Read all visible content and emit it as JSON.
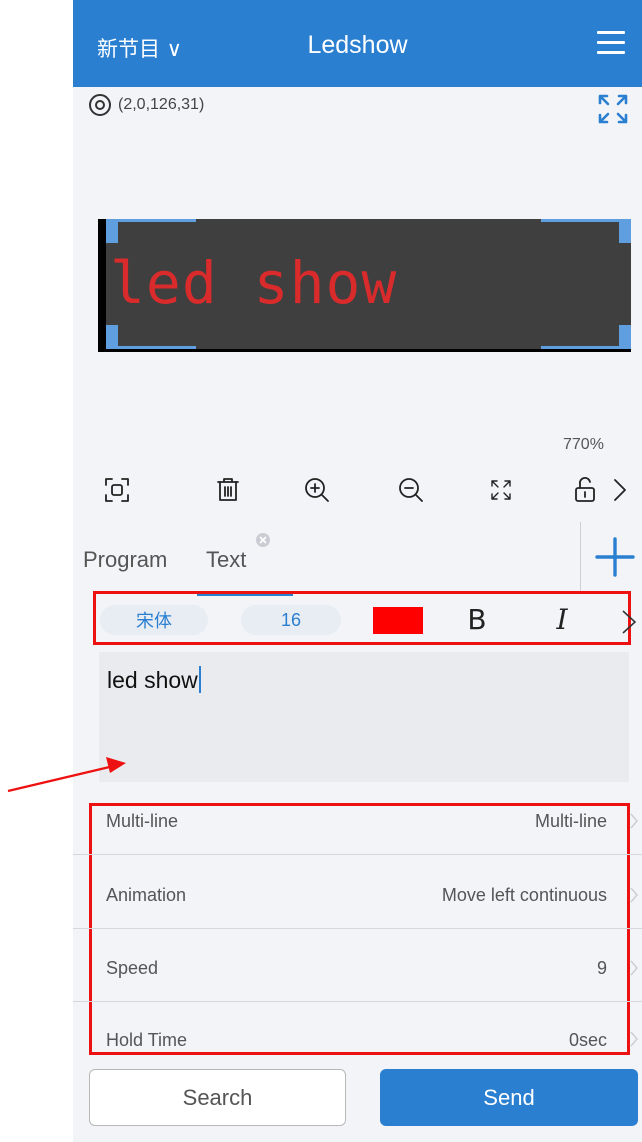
{
  "header": {
    "program_label": "新节目 ∨",
    "title": "Ledshow",
    "menu_icon": "hamburger-icon"
  },
  "canvas": {
    "coordinates": "(2,0,126,31)",
    "led_text": "led show",
    "zoom": "770%"
  },
  "toolbar": {
    "icons": [
      "fit-icon",
      "trash-icon",
      "zoom-in-icon",
      "zoom-out-icon",
      "expand-icon",
      "unlock-icon",
      "chevron-right-icon"
    ]
  },
  "tabs": {
    "items": [
      {
        "label": "Program"
      },
      {
        "label": "Text"
      }
    ]
  },
  "font": {
    "name": "宋体",
    "size": "16",
    "color": "#ff0000",
    "bold": "B",
    "italic": "I"
  },
  "editor": {
    "value": "led show"
  },
  "settings": {
    "items": [
      {
        "label": "Multi-line",
        "value": "Multi-line"
      },
      {
        "label": "Animation",
        "value": "Move left continuous"
      },
      {
        "label": "Speed",
        "value": "9"
      },
      {
        "label": "Hold Time",
        "value": "0sec"
      }
    ]
  },
  "actions": {
    "search_label": "Search",
    "send_label": "Send"
  },
  "colors": {
    "accent": "#2a7fd0",
    "highlight": "#e11111",
    "led_text": "#d92b2b"
  }
}
